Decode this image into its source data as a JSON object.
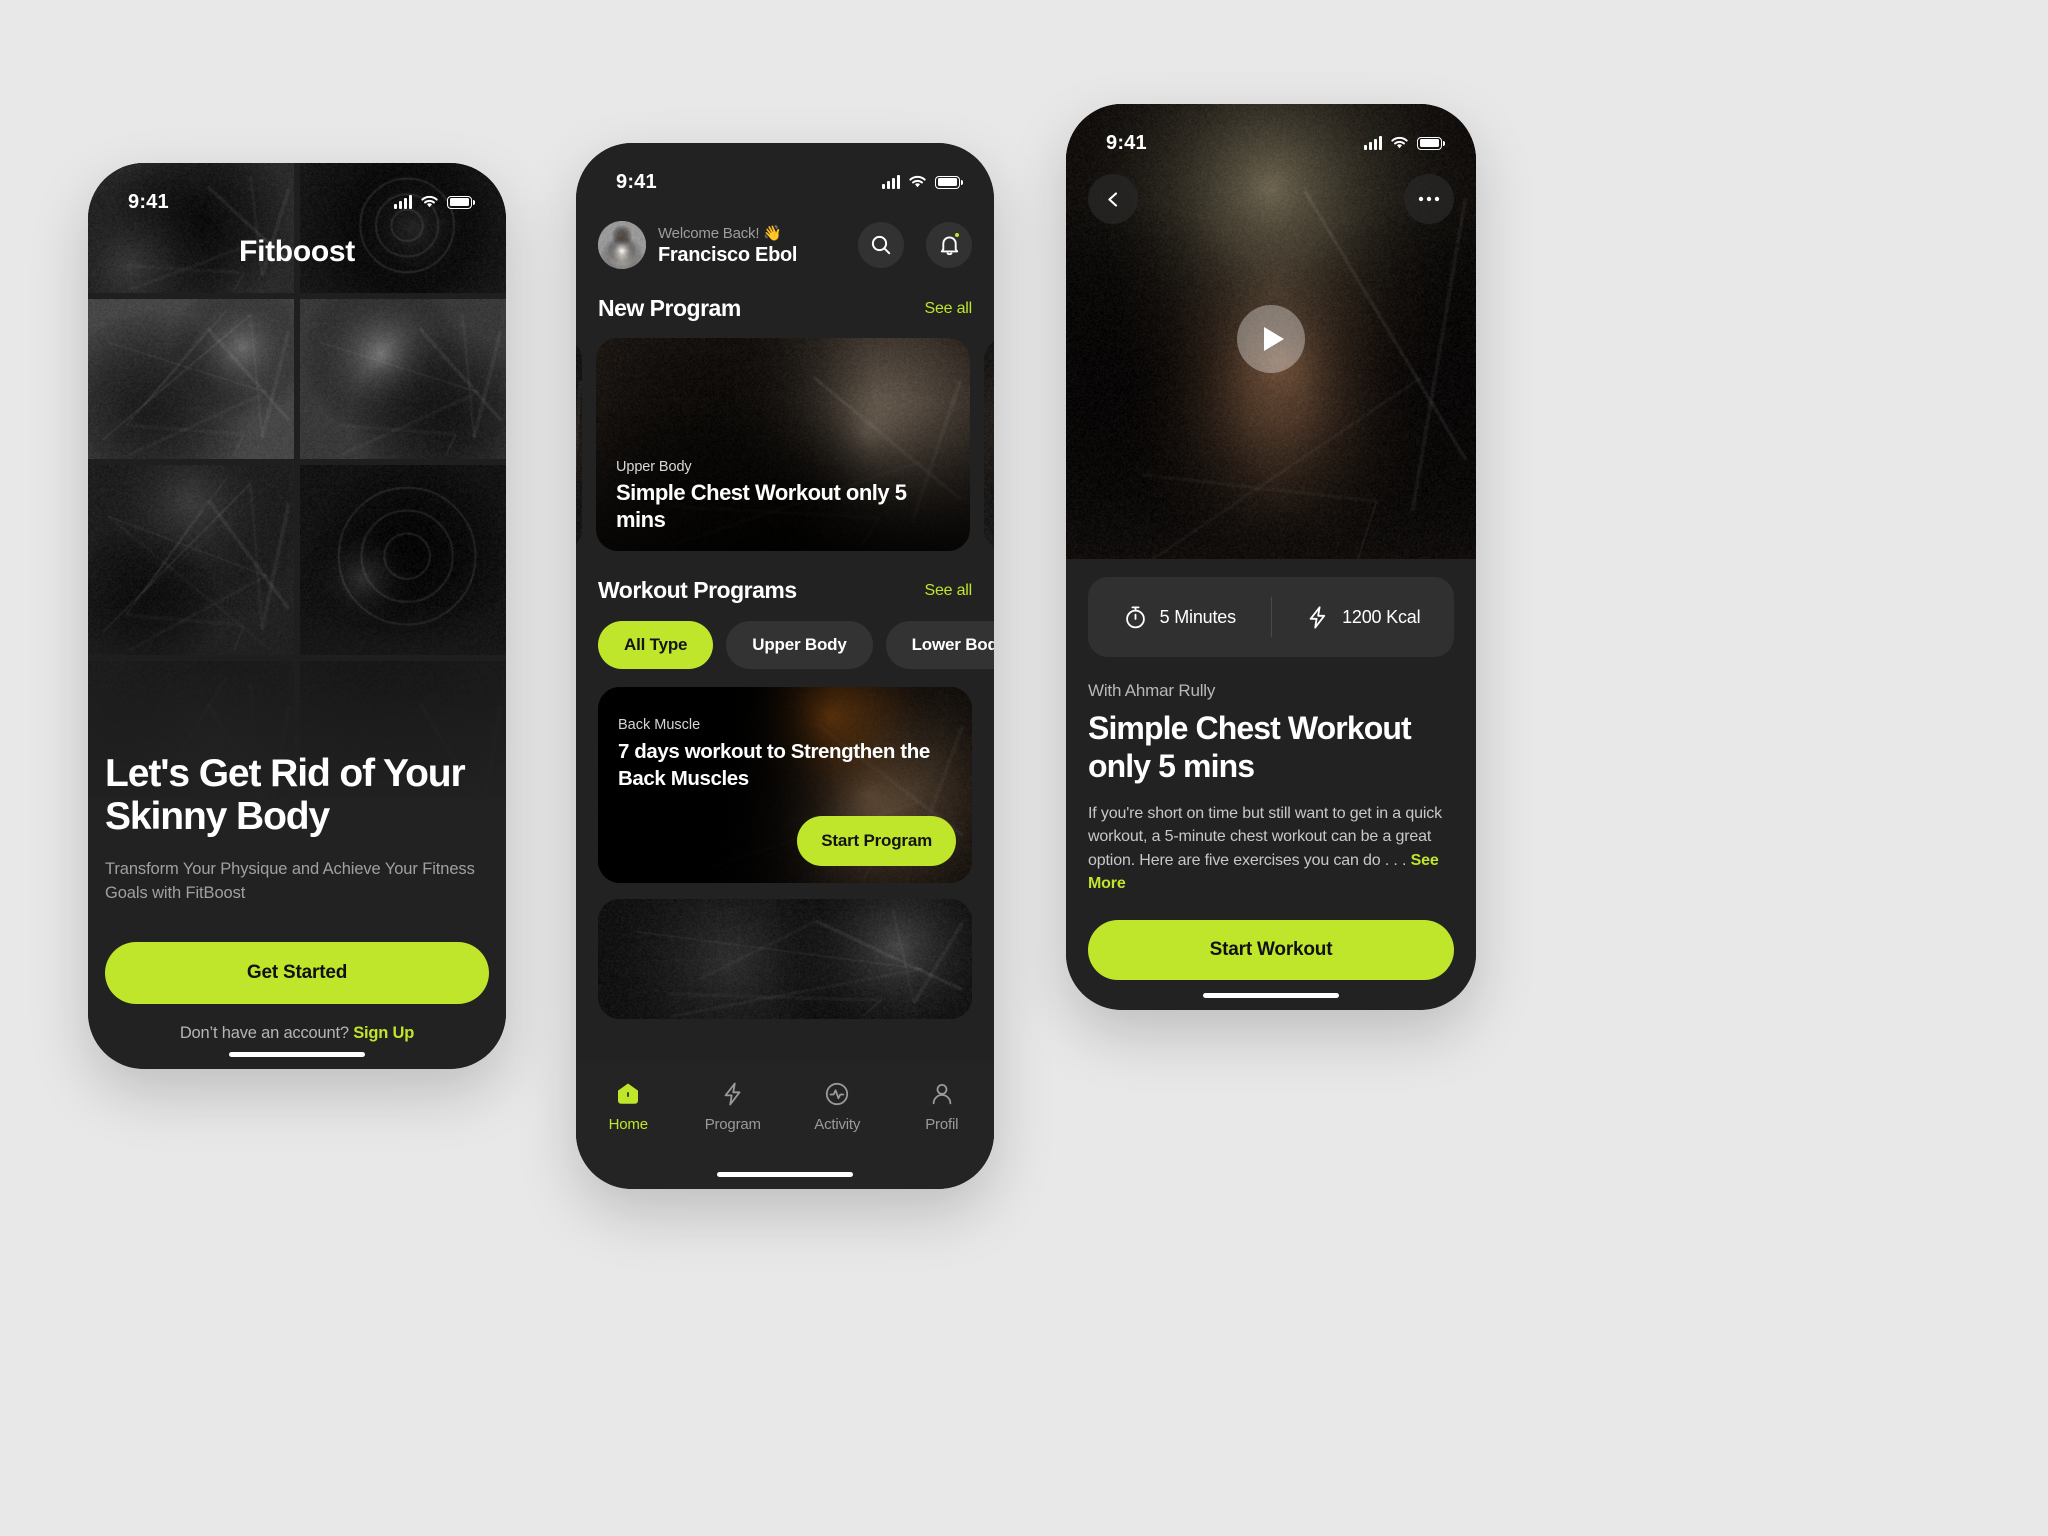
{
  "accent": "#bfe62b",
  "status_bar": {
    "time": "9:41",
    "icons": [
      "signal-icon",
      "wifi-icon",
      "battery-icon"
    ]
  },
  "screen_onboarding": {
    "brand": "Fitboost",
    "headline": "Let's Get Rid of Your Skinny Body",
    "subtitle": "Transform Your Physique and Achieve Your Fitness Goals with FitBoost",
    "cta_label": "Get Started",
    "footer_text": "Don’t have an account?",
    "footer_link": "Sign Up"
  },
  "screen_home": {
    "welcome_label": "Welcome Back! 👋",
    "user_name": "Francisco Ebol",
    "search_icon": "search-icon",
    "bell_icon": "bell-icon",
    "sections": [
      {
        "title": "New Program",
        "see_all": "See all"
      },
      {
        "title": "Workout Programs",
        "see_all": "See all"
      }
    ],
    "new_program_card": {
      "kicker": "Upper Body",
      "title": "Simple Chest Workout only 5 mins"
    },
    "filters": [
      {
        "label": "All Type",
        "active": true
      },
      {
        "label": "Upper Body",
        "active": false
      },
      {
        "label": "Lower Body",
        "active": false
      }
    ],
    "program_card": {
      "kicker": "Back Muscle",
      "title": "7 days workout to Strengthen the Back Muscles",
      "cta_label": "Start Program"
    },
    "tabs": [
      {
        "label": "Home",
        "icon": "home-icon",
        "active": true
      },
      {
        "label": "Program",
        "icon": "bolt-icon",
        "active": false
      },
      {
        "label": "Activity",
        "icon": "activity-icon",
        "active": false
      },
      {
        "label": "Profil",
        "icon": "person-icon",
        "active": false
      }
    ]
  },
  "screen_detail": {
    "back_icon": "chevron-left-icon",
    "more_icon": "more-horizontal-icon",
    "play_icon": "play-icon",
    "stats": [
      {
        "icon": "stopwatch-icon",
        "value": "5 Minutes"
      },
      {
        "icon": "bolt-icon",
        "value": "1200 Kcal"
      }
    ],
    "author": "With Ahmar Rully",
    "title": "Simple Chest Workout only 5 mins",
    "description": "If you're short on time but still want to get in a quick workout, a 5-minute chest workout can be a great option. Here are five exercises you can do . . .",
    "see_more": "See More",
    "cta_label": "Start Workout"
  }
}
